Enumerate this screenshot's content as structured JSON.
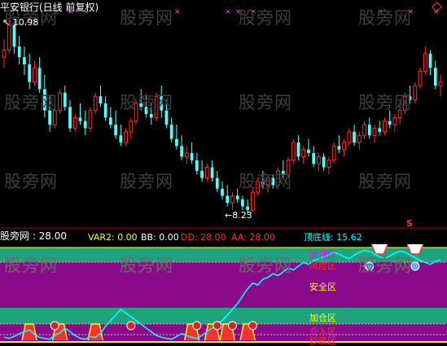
{
  "header": {
    "title": "平安银行(日线 前复权)",
    "title_color": "#ffffff",
    "diamond_icon": "diamond-outline-icon",
    "high_label": "10.98",
    "low_label": "8.23"
  },
  "indicator_bar": {
    "items": [
      {
        "name": "股旁网",
        "value": "28.00",
        "text": "股旁网 : 28.00",
        "color": "#ffffff"
      },
      {
        "name": "VAR2",
        "value": "0.00",
        "text": "VAR2: 0.00",
        "color": "#ffff00"
      },
      {
        "name": "BB",
        "value": "0.00",
        "text": "BB: 0.00",
        "color": "#ffffff"
      },
      {
        "name": "DD",
        "value": "28.00",
        "text": "DD: 28.00",
        "color": "#ff3030"
      },
      {
        "name": "AA",
        "value": "28.00",
        "text": "AA: 28.00",
        "color": "#ff3030"
      },
      {
        "name": "顶底线",
        "value": "15.62",
        "text": "顶底线: 15.62",
        "color": "#00ffff"
      }
    ]
  },
  "zones": [
    {
      "name": "逃顶区",
      "color": "#ff00ff"
    },
    {
      "name": "风险区",
      "color": "#ff3030"
    },
    {
      "name": "安全区",
      "color": "#ffff00"
    },
    {
      "name": "加仓区",
      "color": "#ffff00"
    },
    {
      "name": "介入区",
      "color": "#ff3030"
    },
    {
      "name": "抄底区",
      "color": "#ff3030"
    }
  ],
  "signal_label": "S",
  "watermark": "股旁网",
  "colors": {
    "background": "#000000",
    "up_candle": "#ff3030",
    "down_candle": "#54ffff",
    "oscillator": "#00ffff",
    "band_green": "#1fa37f",
    "band_purple": "#8b0a8b",
    "marker_x": "#ff40ff"
  },
  "chart_data": {
    "type": "candlestick",
    "price_high": 10.98,
    "price_low": 8.23,
    "candles": [
      [
        10.45,
        10.7,
        10.3,
        10.55
      ],
      [
        10.55,
        10.98,
        10.5,
        10.9
      ],
      [
        10.9,
        10.95,
        10.5,
        10.6
      ],
      [
        10.6,
        10.75,
        10.35,
        10.45
      ],
      [
        10.45,
        10.6,
        10.2,
        10.35
      ],
      [
        10.35,
        10.5,
        10.0,
        10.1
      ],
      [
        10.1,
        10.4,
        10.05,
        10.3
      ],
      [
        10.3,
        10.45,
        9.95,
        10.0
      ],
      [
        10.0,
        10.2,
        9.6,
        9.7
      ],
      [
        9.7,
        9.9,
        9.4,
        9.5
      ],
      [
        9.5,
        9.75,
        9.45,
        9.7
      ],
      [
        9.7,
        10.0,
        9.65,
        9.95
      ],
      [
        9.95,
        10.05,
        9.7,
        9.75
      ],
      [
        9.75,
        9.85,
        9.4,
        9.45
      ],
      [
        9.45,
        9.65,
        9.4,
        9.6
      ],
      [
        9.6,
        9.8,
        9.5,
        9.55
      ],
      [
        9.55,
        9.7,
        9.35,
        9.45
      ],
      [
        9.45,
        9.75,
        9.4,
        9.7
      ],
      [
        9.7,
        9.95,
        9.65,
        9.9
      ],
      [
        9.9,
        10.05,
        9.75,
        9.8
      ],
      [
        9.8,
        9.9,
        9.55,
        9.6
      ],
      [
        9.6,
        9.75,
        9.45,
        9.5
      ],
      [
        9.5,
        9.7,
        9.3,
        9.35
      ],
      [
        9.35,
        9.5,
        9.2,
        9.25
      ],
      [
        9.25,
        9.45,
        9.2,
        9.4
      ],
      [
        9.4,
        9.6,
        9.3,
        9.55
      ],
      [
        9.55,
        9.85,
        9.5,
        9.8
      ],
      [
        9.8,
        10.0,
        9.7,
        9.75
      ],
      [
        9.75,
        9.9,
        9.6,
        9.65
      ],
      [
        9.65,
        9.8,
        9.5,
        9.6
      ],
      [
        9.6,
        9.95,
        9.55,
        9.9
      ],
      [
        9.9,
        10.05,
        9.6,
        9.7
      ],
      [
        9.7,
        9.85,
        9.45,
        9.5
      ],
      [
        9.5,
        9.6,
        9.25,
        9.3
      ],
      [
        9.3,
        9.5,
        9.15,
        9.2
      ],
      [
        9.2,
        9.35,
        9.0,
        9.05
      ],
      [
        9.05,
        9.2,
        8.95,
        9.1
      ],
      [
        9.1,
        9.25,
        8.95,
        9.0
      ],
      [
        9.0,
        9.1,
        8.8,
        8.85
      ],
      [
        8.85,
        9.0,
        8.7,
        8.75
      ],
      [
        8.75,
        8.95,
        8.7,
        8.9
      ],
      [
        8.9,
        9.0,
        8.7,
        8.75
      ],
      [
        8.75,
        8.85,
        8.55,
        8.6
      ],
      [
        8.6,
        8.7,
        8.45,
        8.5
      ],
      [
        8.5,
        8.65,
        8.35,
        8.4
      ],
      [
        8.4,
        8.55,
        8.3,
        8.5
      ],
      [
        8.5,
        8.6,
        8.4,
        8.45
      ],
      [
        8.45,
        8.5,
        8.3,
        8.35
      ],
      [
        8.35,
        8.45,
        8.23,
        8.3
      ],
      [
        8.3,
        8.6,
        8.28,
        8.55
      ],
      [
        8.55,
        8.75,
        8.5,
        8.7
      ],
      [
        8.7,
        8.85,
        8.6,
        8.65
      ],
      [
        8.65,
        8.8,
        8.55,
        8.75
      ],
      [
        8.75,
        8.8,
        8.6,
        8.65
      ],
      [
        8.65,
        8.9,
        8.6,
        8.85
      ],
      [
        8.85,
        9.0,
        8.75,
        8.8
      ],
      [
        8.8,
        9.05,
        8.75,
        9.0
      ],
      [
        9.0,
        9.3,
        8.95,
        9.25
      ],
      [
        9.25,
        9.35,
        9.0,
        9.05
      ],
      [
        9.05,
        9.2,
        8.95,
        9.15
      ],
      [
        9.15,
        9.3,
        9.05,
        9.1
      ],
      [
        9.1,
        9.2,
        8.9,
        8.95
      ],
      [
        8.95,
        9.1,
        8.85,
        9.05
      ],
      [
        9.05,
        9.1,
        8.85,
        8.9
      ],
      [
        8.9,
        9.05,
        8.8,
        9.0
      ],
      [
        9.0,
        9.25,
        8.95,
        9.2
      ],
      [
        9.2,
        9.35,
        9.1,
        9.15
      ],
      [
        9.15,
        9.3,
        9.05,
        9.25
      ],
      [
        9.25,
        9.45,
        9.2,
        9.4
      ],
      [
        9.4,
        9.5,
        9.2,
        9.25
      ],
      [
        9.25,
        9.4,
        9.15,
        9.35
      ],
      [
        9.35,
        9.55,
        9.3,
        9.5
      ],
      [
        9.5,
        9.6,
        9.3,
        9.35
      ],
      [
        9.35,
        9.5,
        9.25,
        9.45
      ],
      [
        9.45,
        9.55,
        9.35,
        9.4
      ],
      [
        9.4,
        9.6,
        9.35,
        9.55
      ],
      [
        9.55,
        9.7,
        9.45,
        9.5
      ],
      [
        9.5,
        9.65,
        9.4,
        9.6
      ],
      [
        9.6,
        9.8,
        9.5,
        9.7
      ],
      [
        9.7,
        9.95,
        9.65,
        9.9
      ],
      [
        9.9,
        10.05,
        9.8,
        9.85
      ],
      [
        9.85,
        10.1,
        9.8,
        10.05
      ],
      [
        10.05,
        10.3,
        10.0,
        10.25
      ],
      [
        10.25,
        10.6,
        10.2,
        10.5
      ],
      [
        10.5,
        10.55,
        10.2,
        10.3
      ],
      [
        10.3,
        10.4,
        10.0,
        10.05
      ],
      [
        10.05,
        10.2,
        9.9,
        10.1
      ]
    ],
    "oscillator_range": [
      0,
      100
    ],
    "oscillator": [
      4,
      3,
      5,
      8,
      10,
      12,
      7,
      4,
      3,
      2,
      6,
      9,
      14,
      10,
      6,
      3,
      2,
      5,
      4,
      8,
      16,
      22,
      28,
      34,
      30,
      26,
      22,
      18,
      14,
      10,
      6,
      4,
      3,
      2,
      5,
      8,
      6,
      4,
      3,
      6,
      10,
      14,
      18,
      22,
      28,
      34,
      40,
      48,
      56,
      62,
      60,
      66,
      68,
      72,
      70,
      74,
      78,
      76,
      80,
      84,
      82,
      86,
      88,
      90,
      92,
      95,
      93,
      90,
      88,
      92,
      95,
      97,
      96,
      93,
      90,
      88,
      91,
      94,
      96,
      95,
      92,
      89,
      86,
      84,
      82,
      85,
      87
    ],
    "signals": {
      "cross_markers_top": [
        10,
        13,
        16,
        34,
        44,
        46,
        49,
        74,
        80,
        85
      ],
      "red_ball_markers": [
        10,
        25,
        38,
        42,
        45,
        49
      ],
      "blue_ball_markers": [
        72,
        81
      ],
      "top_notches": [
        74,
        81
      ],
      "bottom_bumps": [
        5,
        11,
        18,
        37,
        41,
        44,
        48
      ]
    }
  }
}
